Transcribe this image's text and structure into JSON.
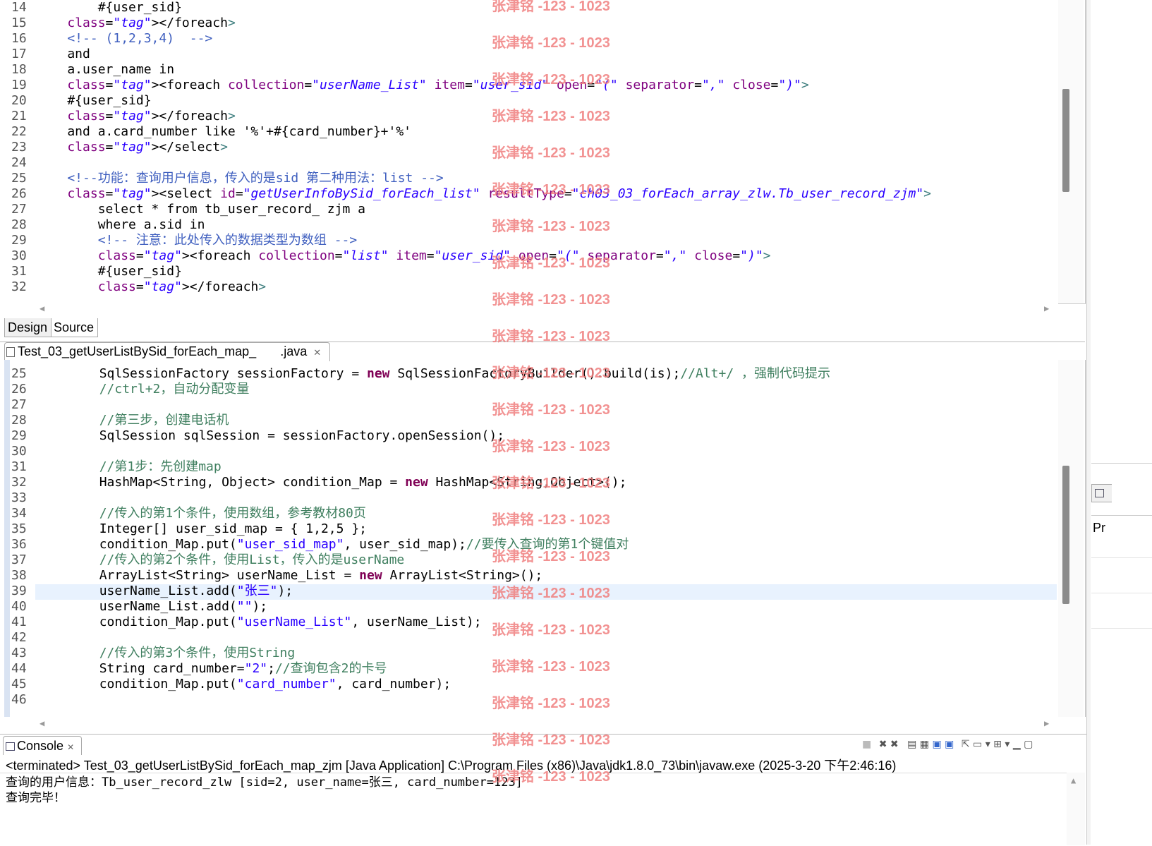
{
  "xml_editor": {
    "lines": [
      {
        "n": "14",
        "html": "        #{user_sid}"
      },
      {
        "n": "15",
        "html": "    </foreach>"
      },
      {
        "n": "16",
        "html": "    <!-- (1,2,3,4)  -->"
      },
      {
        "n": "17",
        "html": "    and"
      },
      {
        "n": "18",
        "html": "    a.user_name in"
      },
      {
        "n": "19",
        "html": "    <foreach collection=\"userName_List\" item=\"user_sid\" open=\"(\" separator=\",\" close=\")\">"
      },
      {
        "n": "20",
        "html": "    #{user_sid}"
      },
      {
        "n": "21",
        "html": "    </foreach>"
      },
      {
        "n": "22",
        "html": "    and a.card_number like '%'+#{card_number}+'%'"
      },
      {
        "n": "23",
        "html": "    </select>"
      },
      {
        "n": "24",
        "html": ""
      },
      {
        "n": "25",
        "html": "    <!--功能：查询用户信息，传入的是sid 第二种用法：list -->"
      },
      {
        "n": "26",
        "html": "    <select id=\"getUserInfoBySid_forEach_list\" resultType=\"ch03_03_forEach_array_zlw.Tb_user_record_zjm\">"
      },
      {
        "n": "27",
        "html": "        select * from tb_user_record_ zjm a"
      },
      {
        "n": "28",
        "html": "        where a.sid in"
      },
      {
        "n": "29",
        "html": "        <!-- 注意：此处传入的数据类型为数组 -->"
      },
      {
        "n": "30",
        "html": "        <foreach collection=\"list\" item=\"user_sid\" open=\"(\" separator=\",\" close=\")\">"
      },
      {
        "n": "31",
        "html": "        #{user_sid}"
      },
      {
        "n": "32",
        "html": "        </foreach>"
      }
    ],
    "tabs": {
      "design": "Design",
      "source": "Source"
    }
  },
  "java_editor": {
    "tab_title": "Test_03_getUserListBySid_forEach_map_",
    "tab_ext": ".java",
    "lines": [
      {
        "n": "25",
        "text": "        SqlSessionFactory sessionFactory = new SqlSessionFactoryBuilder().build(is);//Alt+/ ，强制代码提示"
      },
      {
        "n": "26",
        "text": "        //ctrl+2，自动分配变量"
      },
      {
        "n": "27",
        "text": ""
      },
      {
        "n": "28",
        "text": "        //第三步，创建电话机"
      },
      {
        "n": "29",
        "text": "        SqlSession sqlSession = sessionFactory.openSession();"
      },
      {
        "n": "30",
        "text": ""
      },
      {
        "n": "31",
        "text": "        //第1步：先创建map"
      },
      {
        "n": "32",
        "text": "        HashMap<String, Object> condition_Map = new HashMap<String,Object>();"
      },
      {
        "n": "33",
        "text": ""
      },
      {
        "n": "34",
        "text": "        //传入的第1个条件，使用数组，参考教材80页"
      },
      {
        "n": "35",
        "text": "        Integer[] user_sid_map = { 1,2,5 };"
      },
      {
        "n": "36",
        "text": "        condition_Map.put(\"user_sid_map\", user_sid_map);//要传入查询的第1个键值对"
      },
      {
        "n": "37",
        "text": "        //传入的第2个条件，使用List，传入的是userName"
      },
      {
        "n": "38",
        "text": "        ArrayList<String> userName_List = new ArrayList<String>();"
      },
      {
        "n": "39",
        "text": "        userName_List.add(\"张三\");"
      },
      {
        "n": "40",
        "text": "        userName_List.add(\"\");"
      },
      {
        "n": "41",
        "text": "        condition_Map.put(\"userName_List\", userName_List);"
      },
      {
        "n": "42",
        "text": ""
      },
      {
        "n": "43",
        "text": "        //传入的第3个条件，使用String"
      },
      {
        "n": "44",
        "text": "        String card_number=\"2\";//查询包含2的卡号"
      },
      {
        "n": "45",
        "text": "        condition_Map.put(\"card_number\", card_number);"
      },
      {
        "n": "46",
        "text": ""
      }
    ]
  },
  "console": {
    "title": "Console",
    "status": "<terminated> Test_03_getUserListBySid_forEach_map_zjm [Java Application] C:\\Program Files (x86)\\Java\\jdk1.8.0_73\\bin\\javaw.exe (2025-3-20 下午2:46:16)",
    "output": [
      "查询的用户信息：Tb_user_record_zlw [sid=2, user_name=张三, card_number=123]",
      "查询完毕！"
    ]
  },
  "side": {
    "label": "Pr"
  },
  "watermark": "张津铭 -123 - 1023"
}
